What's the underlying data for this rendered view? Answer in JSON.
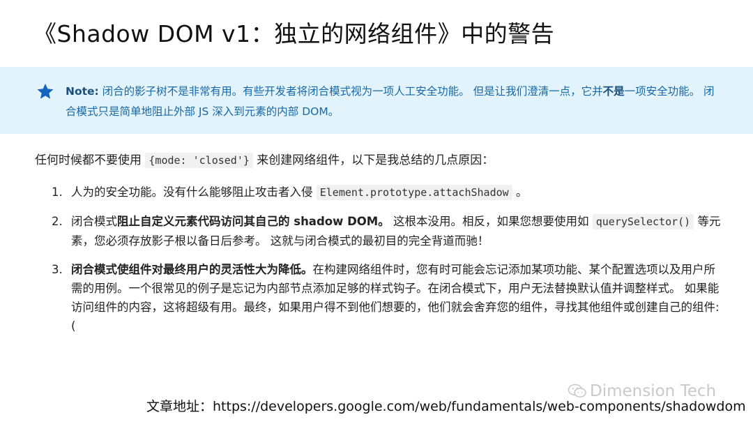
{
  "title": "《Shadow DOM v1：独立的网络组件》中的警告",
  "note": {
    "label": "Note:",
    "text_1": " 闭合的影子树不是非常有用。有些开发者将闭合模式视为一项人工安全功能。 但是让我们澄清一点，它并",
    "bold": "不是",
    "text_2": "一项安全功能。 闭合模式只是简单地阻止外部 JS 深入到元素的内部 DOM。"
  },
  "intro": {
    "before": "任何时候都不要使用 ",
    "code": "{mode: 'closed'}",
    "after": " 来创建网络组件，以下是我总结的几点原因："
  },
  "items": [
    {
      "num": "1.",
      "text_1": "人为的安全功能。没有什么能够阻止攻击者入侵 ",
      "code": "Element.prototype.attachShadow",
      "text_2": " 。"
    },
    {
      "num": "2.",
      "text_1": "闭合模式",
      "bold": "阻止自定义元素代码访问其自己的 shadow DOM。",
      "text_2": " 这根本没用。相反，如果您想要使用如 ",
      "code": "querySelector()",
      "text_3": " 等元素，您必须存放影子根以备日后参考。 这就与闭合模式的最初目的完全背道而驰！"
    },
    {
      "num": "3.",
      "bold": "闭合模式使组件对最终用户的灵活性大为降低。",
      "text_1": "在构建网络组件时，您有时可能会忘记添加某项功能、某个配置选项以及用户所需的用例。一个很常见的例子是忘记为内部节点添加足够的样式钩子。在闭合模式下，用户无法替换默认值并调整样式。 如果能访问组件的内容，这将超级有用。最终，如果用户得不到他们想要的，他们就会舍弃您的组件，寻找其他组件或创建自己的组件:("
    }
  ],
  "watermark": "Dimension Tech",
  "footer": {
    "label": "文章地址：",
    "url": "https://developers.google.com/web/fundamentals/web-components/shadowdom"
  },
  "icons": {
    "note": "star-icon",
    "watermark": "wechat-icon"
  },
  "colors": {
    "note_bg": "#e2f3fb",
    "note_text": "#1668a8",
    "star": "#1565c0"
  }
}
